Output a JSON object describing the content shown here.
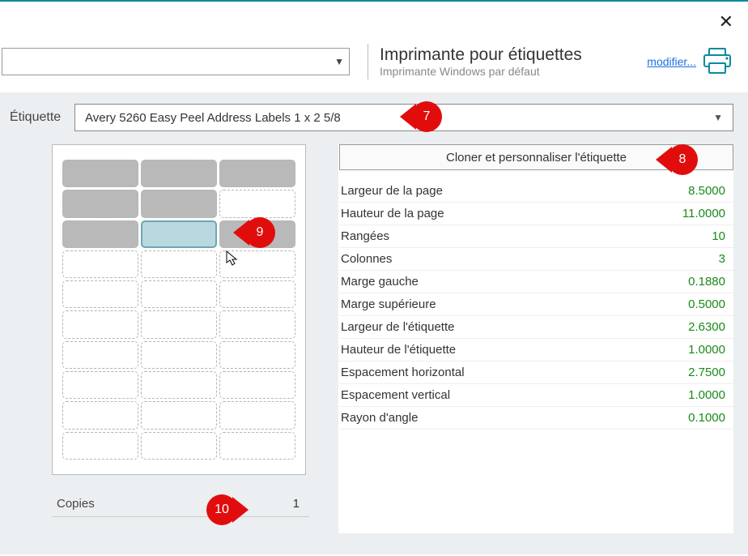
{
  "header": {
    "printer_title": "Imprimante pour étiquettes",
    "printer_subtitle": "Imprimante Windows par défaut",
    "modify_link": "modifier..."
  },
  "etiquette": {
    "label": "Étiquette",
    "selected": "Avery 5260 Easy Peel Address Labels 1 x 2 5/8"
  },
  "clone_button": "Cloner et personnaliser l'étiquette",
  "properties": [
    {
      "label": "Largeur de la page",
      "value": "8.5000"
    },
    {
      "label": "Hauteur de la page",
      "value": "11.0000"
    },
    {
      "label": "Rangées",
      "value": "10"
    },
    {
      "label": "Colonnes",
      "value": "3"
    },
    {
      "label": "Marge gauche",
      "value": "0.1880"
    },
    {
      "label": "Marge supérieure",
      "value": "0.5000"
    },
    {
      "label": "Largeur de l'étiquette",
      "value": "2.6300"
    },
    {
      "label": "Hauteur de l'étiquette",
      "value": "1.0000"
    },
    {
      "label": "Espacement horizontal",
      "value": "2.7500"
    },
    {
      "label": "Espacement vertical",
      "value": "1.0000"
    },
    {
      "label": "Rayon d'angle",
      "value": "0.1000"
    }
  ],
  "sheet": {
    "rows": 10,
    "cols": 3,
    "used_cells": [
      0,
      1,
      2,
      3,
      4,
      6,
      8
    ],
    "selected_cell": 7
  },
  "copies": {
    "label": "Copies",
    "value": "1"
  },
  "annotations": {
    "a7": "7",
    "a8": "8",
    "a9": "9",
    "a10": "10"
  }
}
